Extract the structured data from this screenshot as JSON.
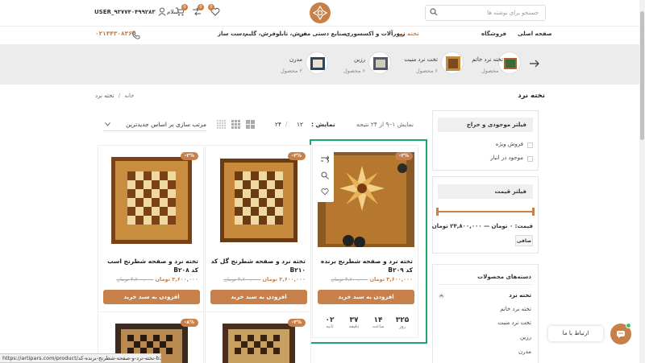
{
  "header": {
    "search_placeholder": "جستجو برای نوشته ها",
    "greeting": "سلام",
    "username": "USER_۹۳۷۷۴۰۴۹۹۲۸۳",
    "cart_count": "0",
    "compare_count": "0",
    "wishlist_count": "0"
  },
  "nav": {
    "items": [
      "صفحه اصلی",
      "فروشگاه",
      "تخته نرد",
      "زیورآلات و اکسسوری",
      "صنایع دستی مس",
      "فرش، تابلوفرش، گلیم",
      "دست ساز"
    ],
    "phone": "۰۲۱۴۴۳۰۸۳۶۲"
  },
  "categories": [
    {
      "name": "تخته نرد خاتم",
      "count": "۰ محصول"
    },
    {
      "name": "تخت نرد منبت",
      "count": "۶ محصول"
    },
    {
      "name": "رزین",
      "count": "۶ محصول"
    },
    {
      "name": "مدرن",
      "count": "۲ محصول"
    }
  ],
  "breadcrumb": {
    "home": "خانه",
    "sep": "/",
    "current": "تخته نرد"
  },
  "page_title": "تخته نرد",
  "toolbar": {
    "results": "نمایش ۱–۹ از ۲۴ نتیجه",
    "show_label": "نمایش :",
    "per_page": [
      "۱۲",
      "۲۴"
    ],
    "sort": "مرتب سازی بر اساس جدیدترین"
  },
  "sidebar": {
    "stock_title": "فیلتر موجودی و حراج",
    "stock_options": [
      "فروش ویژه",
      "موجود در انبار"
    ],
    "price_title": "فیلتر قیمت",
    "price_range": "قیمت: ۰ تومان — ۲۴,۸۰۰,۰۰۰ تومان",
    "filter_button": "صافی",
    "cats_title": "دسته‌های محصولات",
    "cats_parent": "تخته نرد",
    "cats_children": [
      "تخته نرد خاتم",
      "تخت نرد منبت",
      "رزین",
      "مدرن"
    ]
  },
  "products": [
    {
      "badge": "-۳%",
      "title": "تخته نرد و صفحه شطرنج برنده کد B۲۰۹",
      "old": "۳,۷۰۰,۰۰۰ تومان",
      "new": "۳,۶۰۰,۰۰۰ تومان",
      "button": "افزودن به سبد خرید"
    },
    {
      "badge": "-۳%",
      "title": "تخته نرد و صفحه شطرنج گل کد B۲۱۰",
      "old": "۳,۷۰۰,۰۰۰ تومان",
      "new": "۳,۶۰۰,۰۰۰ تومان",
      "button": "افزودن به سبد خرید"
    },
    {
      "badge": "-۳%",
      "title": "تخته نرد و صفحه شطرنج اسب کد B۲۰۸",
      "old": "۳,۷۰۰,۰۰۰ تومان",
      "new": "۳,۶۰۰,۰۰۰ تومان",
      "button": "افزودن به سبد خرید"
    },
    {
      "badge": "-۳%"
    },
    {
      "badge": "-۸%"
    }
  ],
  "countdown": {
    "days": "۳۲۵",
    "days_label": "روز",
    "hours": "۱۴",
    "hours_label": "ساعت",
    "minutes": "۳۷",
    "minutes_label": "دقیقه",
    "seconds": "۰۲",
    "seconds_label": "ثانیه"
  },
  "chat_label": "ارتباط با ما",
  "status_url": "https://artipars.com/product/تخته-نرد-و-صفحه-شطرنج-برنده-کد-b209/",
  "colors": {
    "accent": "#c8804a",
    "highlight": "#22a46a"
  }
}
